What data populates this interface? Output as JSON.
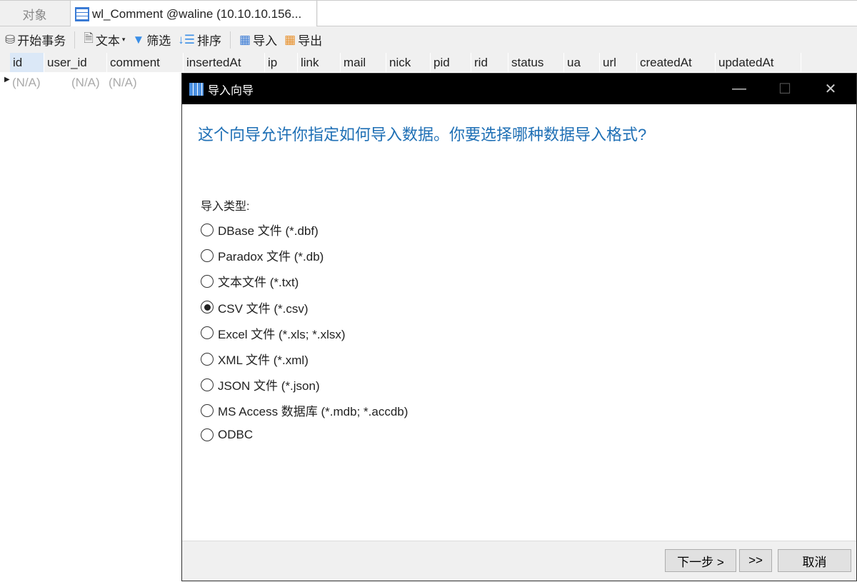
{
  "tabs": [
    {
      "label": "对象"
    },
    {
      "label": "wl_Comment @waline (10.10.10.156..."
    }
  ],
  "toolbar": {
    "begin_tx": "开始事务",
    "text": "文本",
    "filter": "筛选",
    "sort": "排序",
    "import": "导入",
    "export": "导出"
  },
  "columns": [
    "id",
    "user_id",
    "comment",
    "insertedAt",
    "ip",
    "link",
    "mail",
    "nick",
    "pid",
    "rid",
    "status",
    "ua",
    "url",
    "createdAt",
    "updatedAt"
  ],
  "row": [
    "(N/A)",
    "(N/A)",
    "(N/A)"
  ],
  "dialog": {
    "title": "导入向导",
    "question": "这个向导允许你指定如何导入数据。你要选择哪种数据导入格式?",
    "type_label": "导入类型:",
    "options": [
      {
        "label": "DBase 文件 (*.dbf)",
        "selected": false
      },
      {
        "label": "Paradox 文件 (*.db)",
        "selected": false
      },
      {
        "label": "文本文件 (*.txt)",
        "selected": false
      },
      {
        "label": "CSV 文件 (*.csv)",
        "selected": true
      },
      {
        "label": "Excel 文件 (*.xls; *.xlsx)",
        "selected": false
      },
      {
        "label": "XML 文件 (*.xml)",
        "selected": false
      },
      {
        "label": "JSON 文件 (*.json)",
        "selected": false
      },
      {
        "label": "MS Access 数据库 (*.mdb; *.accdb)",
        "selected": false
      },
      {
        "label": "ODBC",
        "selected": false
      }
    ],
    "next": "下一步 >",
    "last": ">>",
    "cancel": "取消"
  },
  "colors": {
    "accent": "#1e6fb5",
    "titlebar": "#000000"
  }
}
